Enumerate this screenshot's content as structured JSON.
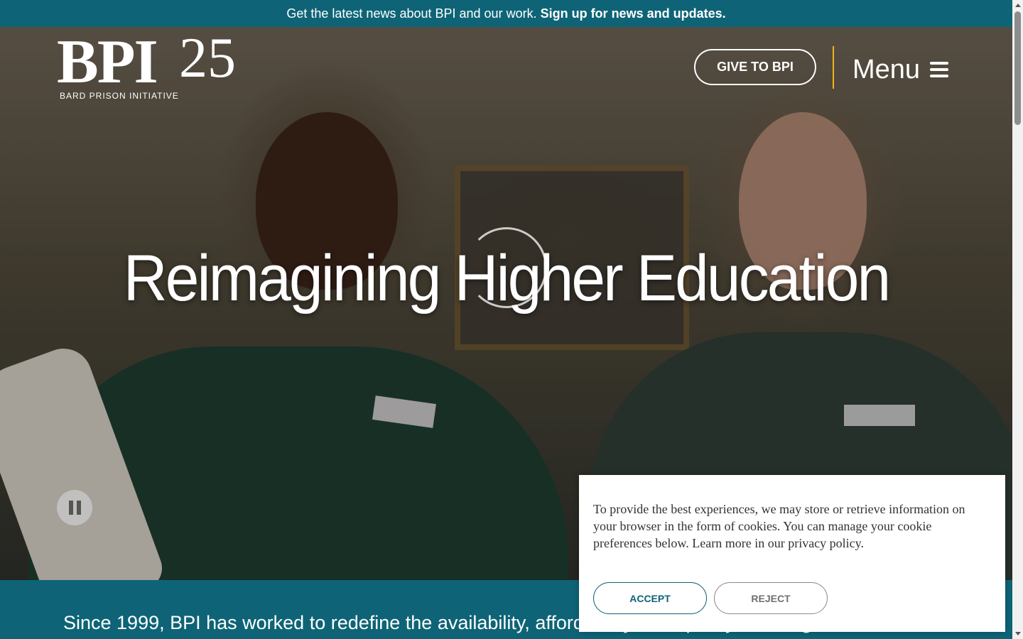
{
  "announcement": {
    "text": "Get the latest news about BPI and our work.",
    "link": "Sign up for news and updates."
  },
  "header": {
    "logo_mark": "BPI",
    "logo_number": "25",
    "logo_subtitle": "BARD PRISON INITIATIVE",
    "give_button": "GIVE TO BPI",
    "menu_label": "Menu"
  },
  "hero": {
    "headline": "Reimagining Higher Education"
  },
  "intro": {
    "text": "Since 1999, BPI has worked to redefine the availability, affordability, and quality of college for incarcerated people…"
  },
  "cookie_banner": {
    "message": "To provide the best experiences, we may store or retrieve information on your browser in the form of cookies. You can manage your cookie preferences below. Learn more in our privacy policy.",
    "accept_label": "ACCEPT",
    "reject_label": "REJECT"
  },
  "colors": {
    "brand_teal": "#0e6476",
    "accent_gold": "#f2b31b",
    "white": "#ffffff"
  }
}
